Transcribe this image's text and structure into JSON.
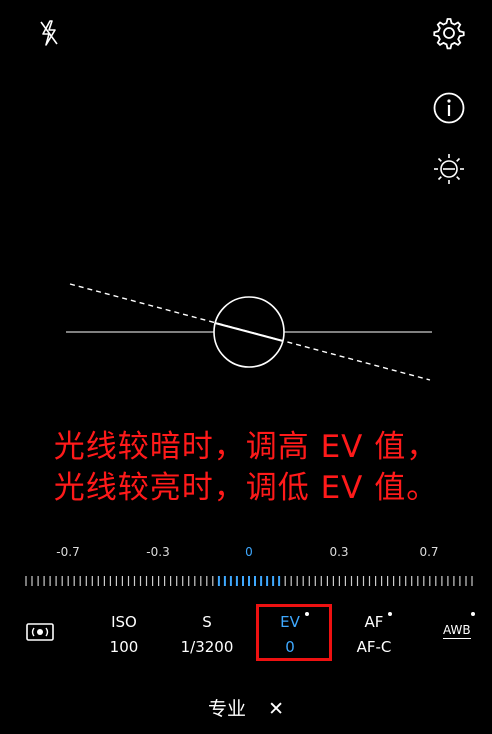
{
  "top_icons": {
    "flash": "flash-off-icon",
    "settings": "gear-icon",
    "info": "info-icon",
    "brightness": "brightness-icon"
  },
  "annotation": {
    "line1": "光线较暗时，调高 EV 值，",
    "line2": "光线较亮时，调低 EV 值。",
    "color": "#ff1a1a"
  },
  "ev_scale": {
    "labels": [
      "-0.7",
      "-0.3",
      "0",
      "0.3",
      "0.7"
    ],
    "selected": "0",
    "accent": "#3fa9ff"
  },
  "params": {
    "metering_icon": "metering-mode-icon",
    "iso": {
      "name": "ISO",
      "value": "100"
    },
    "shutter": {
      "name": "S",
      "value": "1/3200"
    },
    "ev": {
      "name": "EV",
      "value": "0"
    },
    "af": {
      "name": "AF",
      "value": "AF-C"
    },
    "awb": {
      "name": "AWB"
    }
  },
  "mode": {
    "label": "专业",
    "close": "✕"
  }
}
